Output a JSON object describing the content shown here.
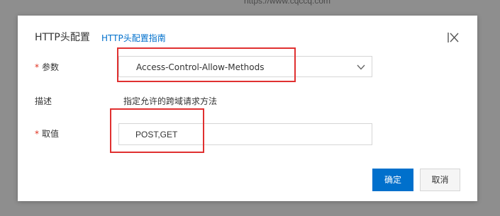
{
  "background": {
    "url_text": "https://www.cqccq.com"
  },
  "dialog": {
    "title": "HTTP头配置",
    "guide_link": "HTTP头配置指南",
    "close_icon": "close-icon"
  },
  "form": {
    "param": {
      "required_mark": "*",
      "label": "参数",
      "selected_value": "Access-Control-Allow-Methods",
      "dropdown_icon": "chevron-down-icon"
    },
    "description": {
      "label": "描述",
      "text": "指定允许的跨域请求方法"
    },
    "value": {
      "required_mark": "*",
      "label": "取值",
      "input_value": "POST,GET"
    }
  },
  "buttons": {
    "confirm": "确定",
    "cancel": "取消"
  },
  "colors": {
    "accent": "#0070cc",
    "required": "#e0301e",
    "highlight": "#e03030",
    "overlay": "#8e8e8e"
  }
}
